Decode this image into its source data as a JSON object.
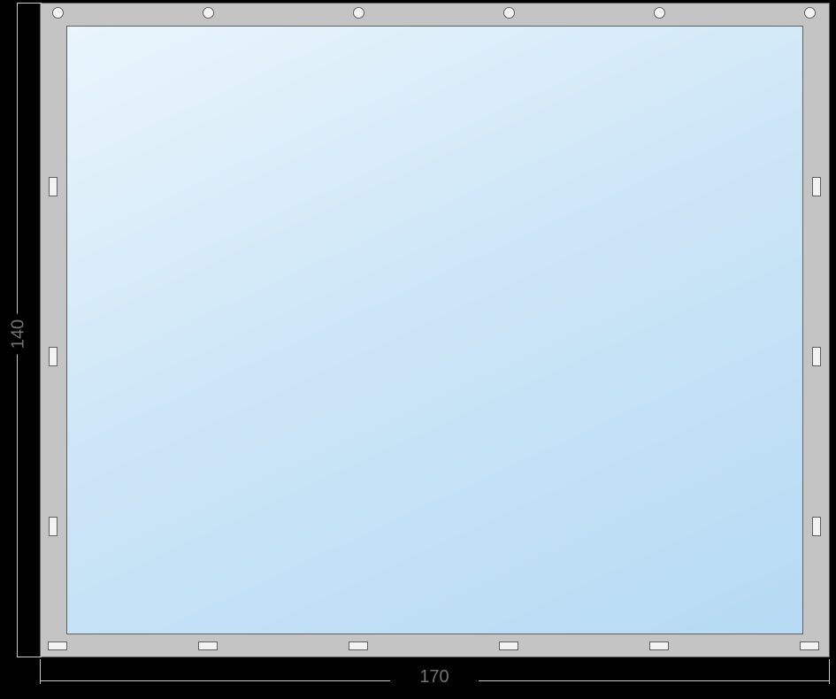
{
  "dimensions": {
    "width_label": "170",
    "height_label": "140"
  },
  "frame": {
    "outer_color": "#c4c4c4",
    "glass_gradient_start": "#eaf5fc",
    "glass_gradient_end": "#b6daf4"
  },
  "connectors": {
    "top_type": "round-hole",
    "top_count": 6,
    "side_type": "vertical-slot",
    "side_count_per_side": 3,
    "bottom_type": "horizontal-slot",
    "bottom_count": 6
  }
}
